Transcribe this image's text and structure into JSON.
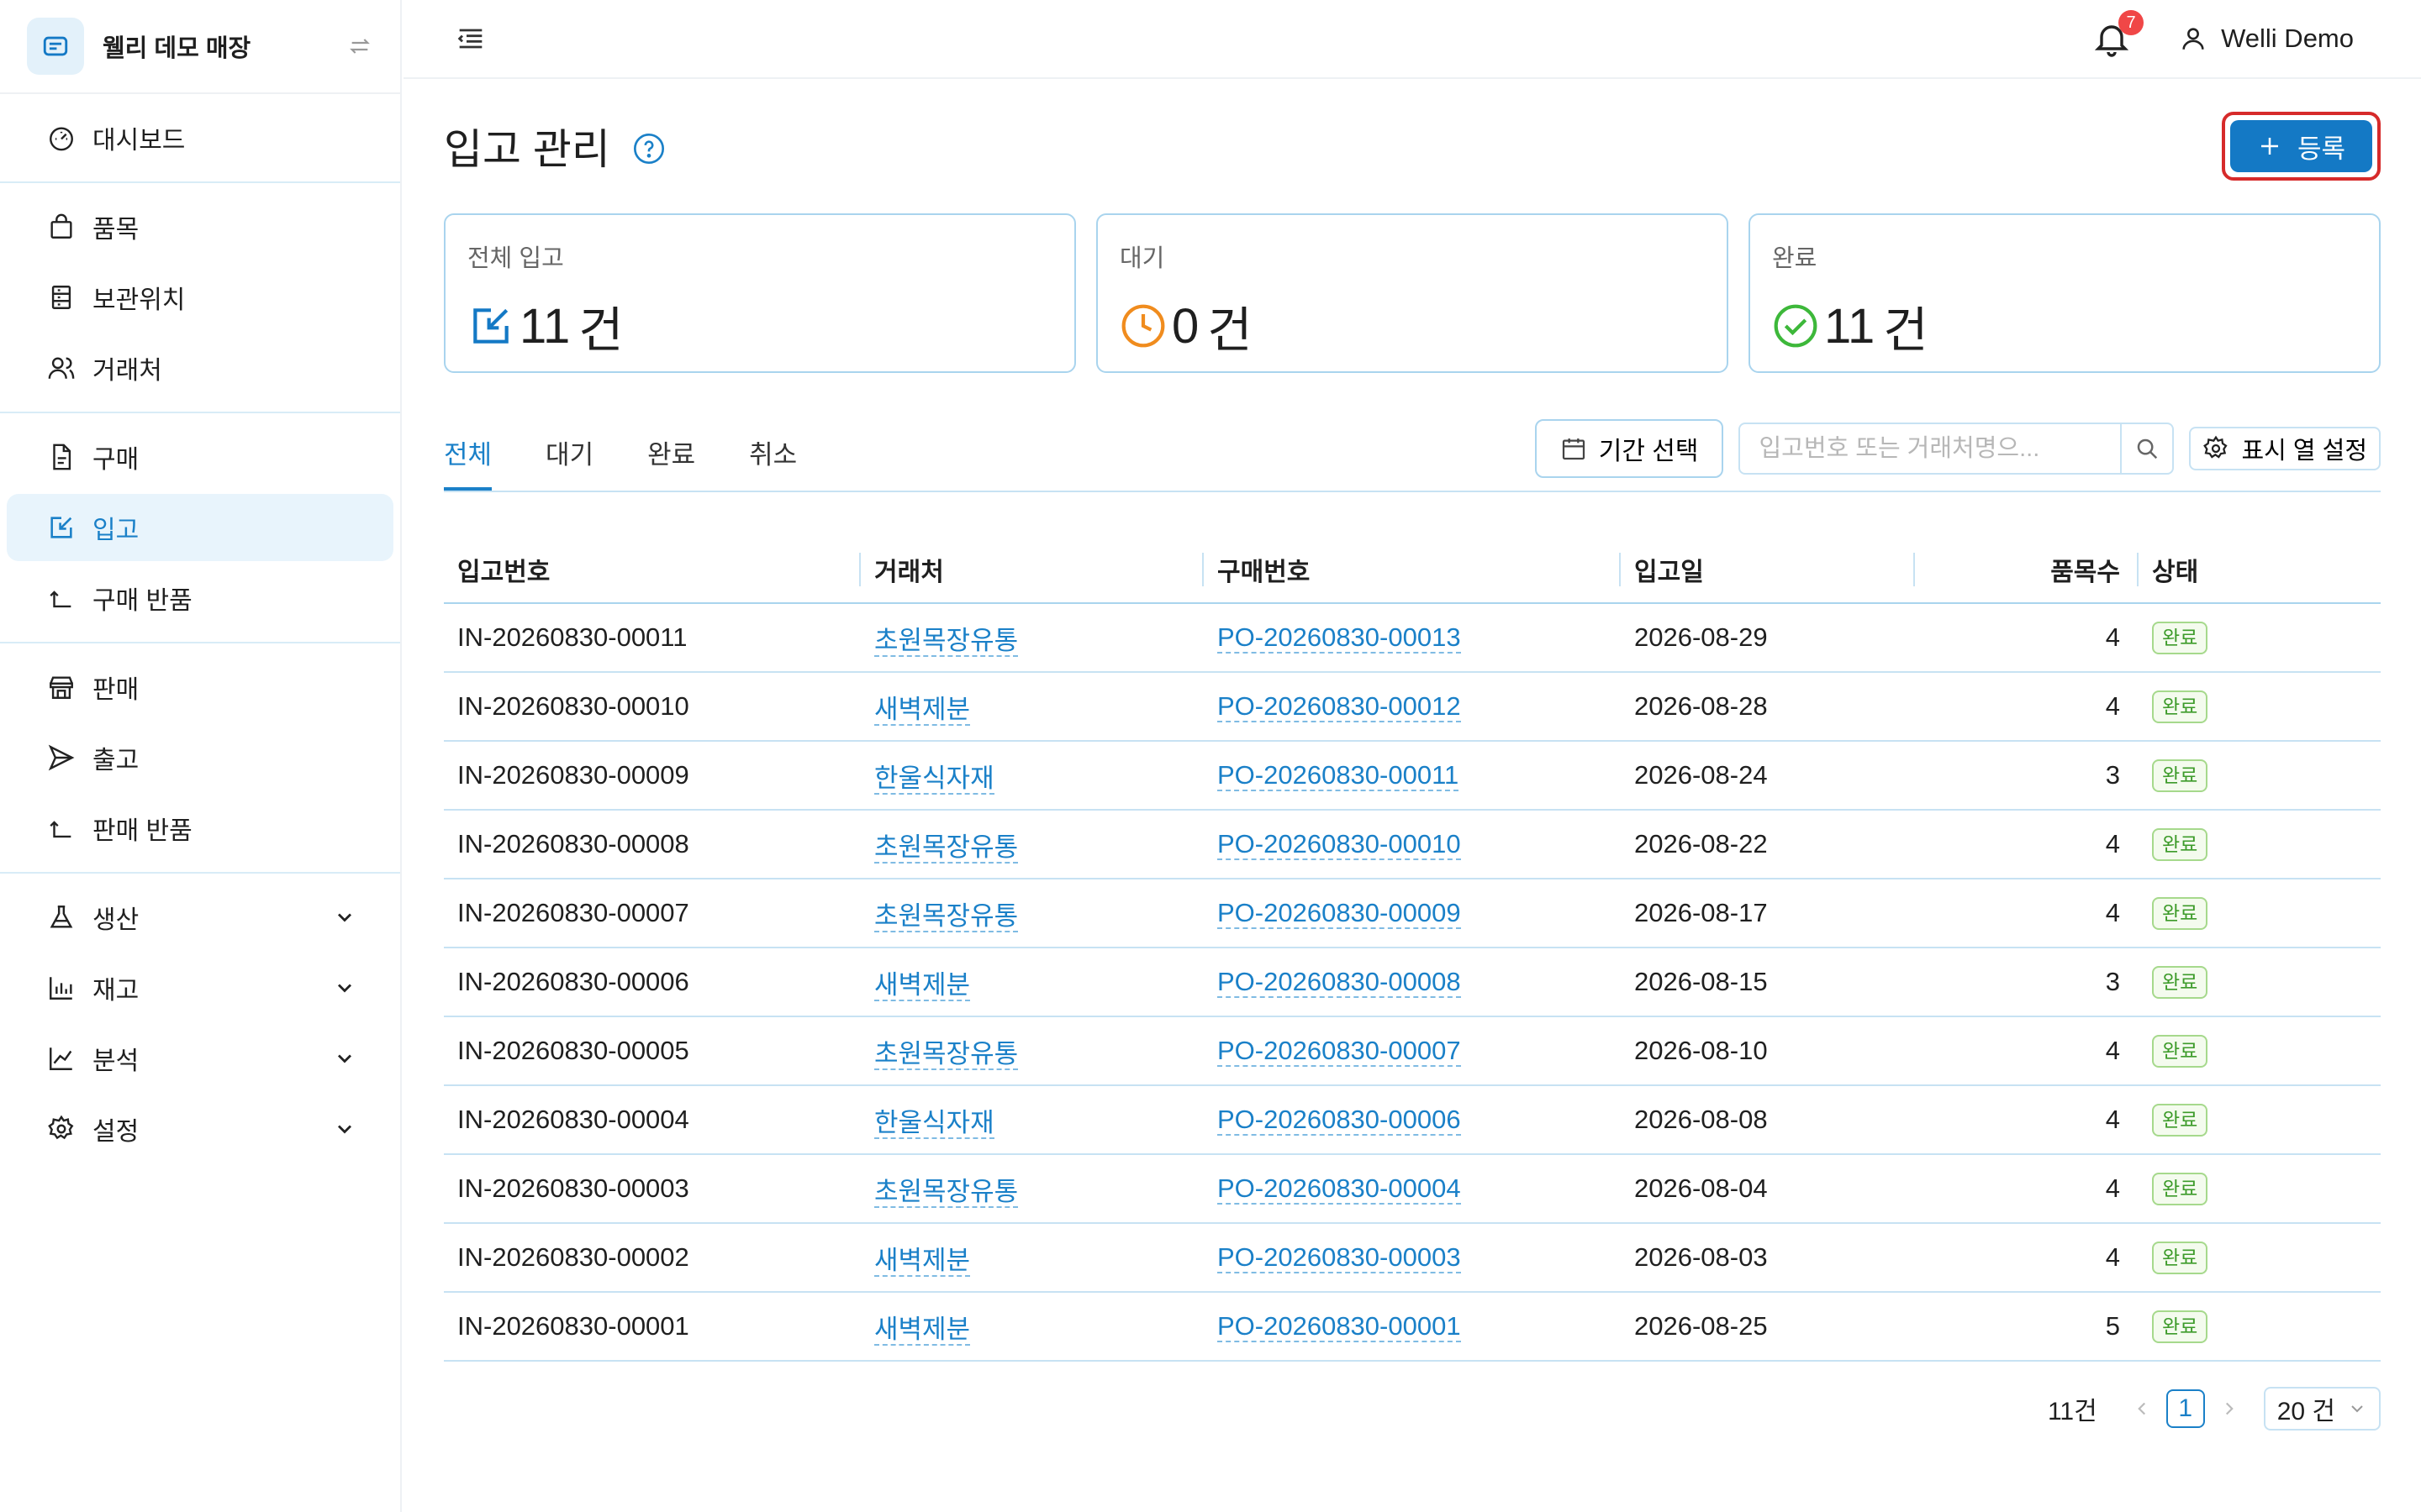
{
  "sidebar": {
    "store_name": "웰리 데모 매장",
    "groups": [
      [
        {
          "label": "대시보드",
          "icon": "dashboard-icon"
        }
      ],
      [
        {
          "label": "품목",
          "icon": "bag-icon"
        },
        {
          "label": "보관위치",
          "icon": "storage-icon"
        },
        {
          "label": "거래처",
          "icon": "partner-icon"
        }
      ],
      [
        {
          "label": "구매",
          "icon": "document-icon"
        },
        {
          "label": "입고",
          "icon": "inbound-icon",
          "active": true
        },
        {
          "label": "구매 반품",
          "icon": "return-icon"
        }
      ],
      [
        {
          "label": "판매",
          "icon": "store-icon"
        },
        {
          "label": "출고",
          "icon": "send-icon"
        },
        {
          "label": "판매 반품",
          "icon": "return-icon"
        }
      ],
      [
        {
          "label": "생산",
          "icon": "flask-icon"
        },
        {
          "label": "재고",
          "icon": "bar-chart-icon"
        },
        {
          "label": "분석",
          "icon": "line-chart-icon"
        },
        {
          "label": "설정",
          "icon": "gear-icon"
        }
      ]
    ]
  },
  "header": {
    "notification_count": "7",
    "user_name": "Welli Demo"
  },
  "page": {
    "title": "입고 관리",
    "register_label": "등록"
  },
  "stats": [
    {
      "label": "전체 입고",
      "value": "11",
      "unit": "건",
      "color": "#1479c5"
    },
    {
      "label": "대기",
      "value": "0",
      "unit": "건",
      "color": "#f08c1e"
    },
    {
      "label": "완료",
      "value": "11",
      "unit": "건",
      "color": "#3db83a"
    }
  ],
  "tabs": [
    "전체",
    "대기",
    "완료",
    "취소"
  ],
  "toolbar": {
    "period_label": "기간 선택",
    "search_placeholder": "입고번호 또는 거래처명으...",
    "columns_label": "표시 열 설정"
  },
  "table": {
    "headers": [
      "입고번호",
      "거래처",
      "구매번호",
      "입고일",
      "품목수",
      "상태"
    ],
    "rows": [
      [
        "IN-20260830-00011",
        "초원목장유통",
        "PO-20260830-00013",
        "2026-08-29",
        "4",
        "완료"
      ],
      [
        "IN-20260830-00010",
        "새벽제분",
        "PO-20260830-00012",
        "2026-08-28",
        "4",
        "완료"
      ],
      [
        "IN-20260830-00009",
        "한울식자재",
        "PO-20260830-00011",
        "2026-08-24",
        "3",
        "완료"
      ],
      [
        "IN-20260830-00008",
        "초원목장유통",
        "PO-20260830-00010",
        "2026-08-22",
        "4",
        "완료"
      ],
      [
        "IN-20260830-00007",
        "초원목장유통",
        "PO-20260830-00009",
        "2026-08-17",
        "4",
        "완료"
      ],
      [
        "IN-20260830-00006",
        "새벽제분",
        "PO-20260830-00008",
        "2026-08-15",
        "3",
        "완료"
      ],
      [
        "IN-20260830-00005",
        "초원목장유통",
        "PO-20260830-00007",
        "2026-08-10",
        "4",
        "완료"
      ],
      [
        "IN-20260830-00004",
        "한울식자재",
        "PO-20260830-00006",
        "2026-08-08",
        "4",
        "완료"
      ],
      [
        "IN-20260830-00003",
        "초원목장유통",
        "PO-20260830-00004",
        "2026-08-04",
        "4",
        "완료"
      ],
      [
        "IN-20260830-00002",
        "새벽제분",
        "PO-20260830-00003",
        "2026-08-03",
        "4",
        "완료"
      ],
      [
        "IN-20260830-00001",
        "새벽제분",
        "PO-20260830-00001",
        "2026-08-25",
        "5",
        "완료"
      ]
    ]
  },
  "pagination": {
    "total": "11건",
    "current_page": "1",
    "page_size": "20 건"
  }
}
